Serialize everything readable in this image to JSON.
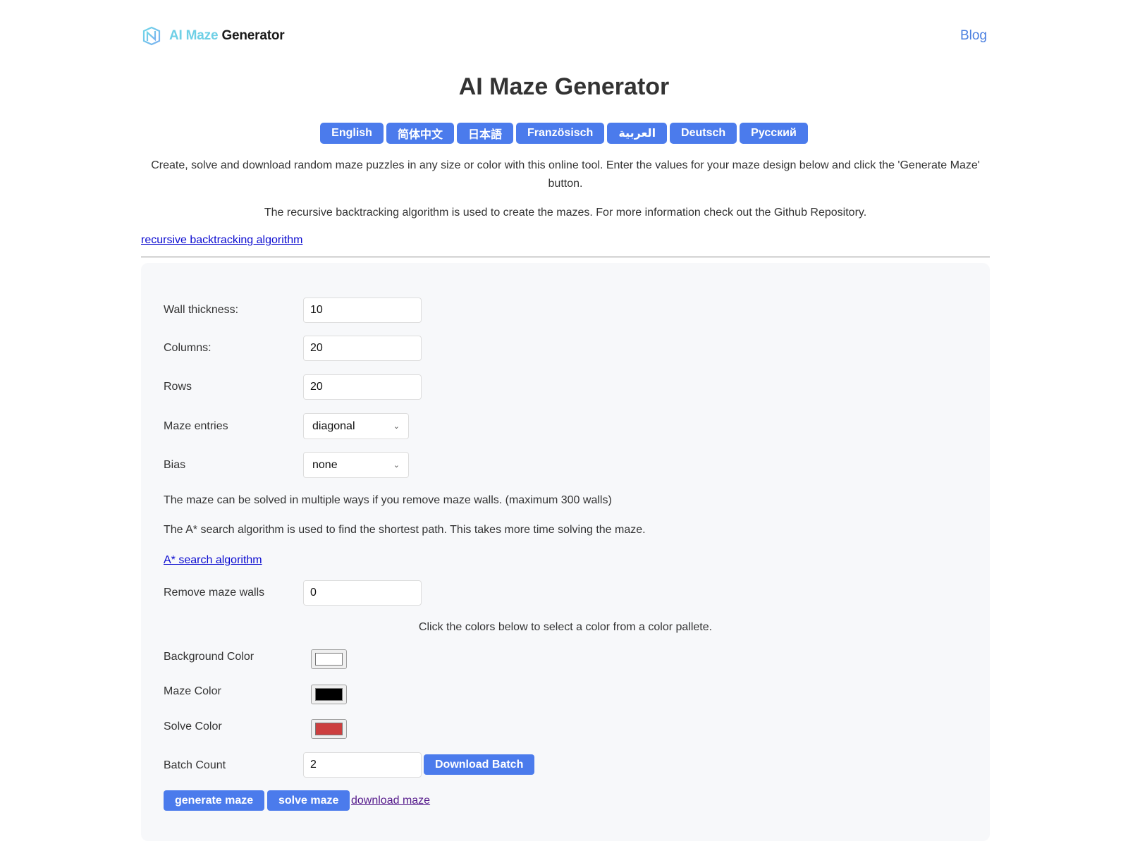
{
  "header": {
    "logo_ai": "AI Maze",
    "logo_gen": "Generator",
    "blog_label": "Blog"
  },
  "page": {
    "title": "AI Maze Generator",
    "intro": "Create, solve and download random maze puzzles in any size or color with this online tool. Enter the values for your maze design below and click the 'Generate Maze' button.",
    "intro2": "The recursive backtracking algorithm is used to create the mazes. For more information check out the Github Repository.",
    "algo_link": "recursive backtracking algorithm"
  },
  "languages": [
    "English",
    "简体中文",
    "日本語",
    "Französisch",
    "العربية",
    "Deutsch",
    "Русский"
  ],
  "form": {
    "wall_thickness": {
      "label": "Wall thickness:",
      "value": "10"
    },
    "columns": {
      "label": "Columns:",
      "value": "20"
    },
    "rows": {
      "label": "Rows",
      "value": "20"
    },
    "maze_entries": {
      "label": "Maze entries",
      "selected": "diagonal"
    },
    "bias": {
      "label": "Bias",
      "selected": "none"
    },
    "remove_note": "The maze can be solved in multiple ways if you remove maze walls. (maximum 300 walls)",
    "astar_note": "The A* search algorithm is used to find the shortest path. This takes more time solving the maze.",
    "astar_link": "A* search algorithm",
    "remove_walls": {
      "label": "Remove maze walls",
      "value": "0"
    },
    "color_hint": "Click the colors below to select a color from a color pallete.",
    "background_color": {
      "label": "Background Color",
      "value": "#ffffff"
    },
    "maze_color": {
      "label": "Maze Color",
      "value": "#000000"
    },
    "solve_color": {
      "label": "Solve Color",
      "value": "#cc3f3f"
    },
    "batch_count": {
      "label": "Batch Count",
      "value": "2"
    },
    "download_batch": "Download Batch",
    "generate": "generate maze",
    "solve": "solve maze",
    "download": "download maze"
  },
  "colors": {
    "accent": "#4b7bec",
    "logo_cyan": "#6fd0e6",
    "link": "#0b0bd0",
    "visited_link": "#551a8b"
  }
}
